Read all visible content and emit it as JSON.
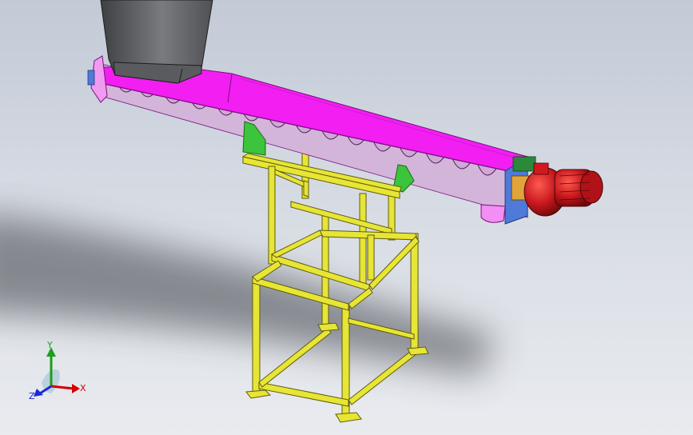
{
  "viewport": {
    "colors": {
      "frame": "#e7e535",
      "frame_edge": "#5f5c0e",
      "trough": "#f21ef2",
      "trough_edge": "#7a1080",
      "hopper": "#6f7073",
      "motor": "#c4161c",
      "bracket": "#3cc43c",
      "end_plate": "#4f7ad8"
    }
  },
  "triad": {
    "x_label": "X",
    "y_label": "Y",
    "z_label": "Z",
    "colors": {
      "x": "#d40000",
      "y": "#1aa01a",
      "z": "#1a2ad4"
    }
  }
}
